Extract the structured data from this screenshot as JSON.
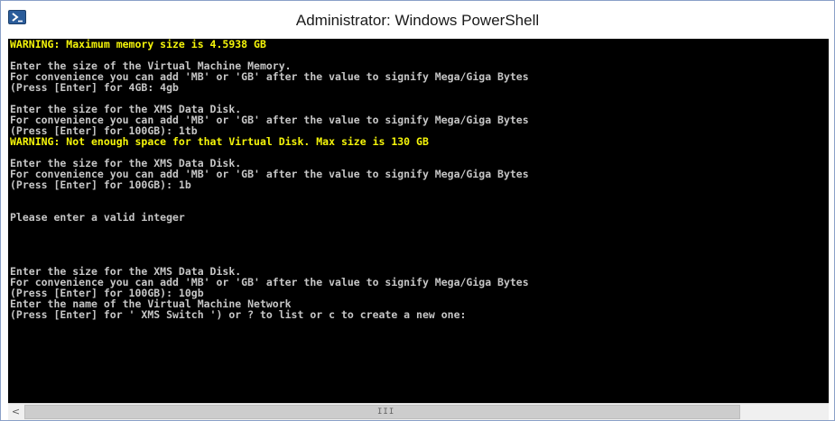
{
  "window": {
    "title": "Administrator: Windows PowerShell",
    "icon": "powershell-icon"
  },
  "console": {
    "foreground": "#c6c6c6",
    "warning_color": "#f5f50a",
    "background": "#000000",
    "lines": [
      {
        "text": "WARNING: Maximum memory size is 4.5938 GB",
        "warn": true
      },
      {
        "text": "",
        "warn": false
      },
      {
        "text": "Enter the size of the Virtual Machine Memory.",
        "warn": false
      },
      {
        "text": "For convenience you can add 'MB' or 'GB' after the value to signify Mega/Giga Bytes",
        "warn": false
      },
      {
        "text": "(Press [Enter] for 4GB: 4gb",
        "warn": false
      },
      {
        "text": "",
        "warn": false
      },
      {
        "text": "Enter the size for the XMS Data Disk.",
        "warn": false
      },
      {
        "text": "For convenience you can add 'MB' or 'GB' after the value to signify Mega/Giga Bytes",
        "warn": false
      },
      {
        "text": "(Press [Enter] for 100GB): 1tb",
        "warn": false
      },
      {
        "text": "WARNING: Not enough space for that Virtual Disk. Max size is 130 GB",
        "warn": true
      },
      {
        "text": "",
        "warn": false
      },
      {
        "text": "Enter the size for the XMS Data Disk.",
        "warn": false
      },
      {
        "text": "For convenience you can add 'MB' or 'GB' after the value to signify Mega/Giga Bytes",
        "warn": false
      },
      {
        "text": "(Press [Enter] for 100GB): 1b",
        "warn": false
      },
      {
        "text": "",
        "warn": false
      },
      {
        "text": "",
        "warn": false
      },
      {
        "text": "Please enter a valid integer",
        "warn": false
      },
      {
        "text": "",
        "warn": false
      },
      {
        "text": "",
        "warn": false
      },
      {
        "text": "",
        "warn": false
      },
      {
        "text": "",
        "warn": false
      },
      {
        "text": "Enter the size for the XMS Data Disk.",
        "warn": false
      },
      {
        "text": "For convenience you can add 'MB' or 'GB' after the value to signify Mega/Giga Bytes",
        "warn": false
      },
      {
        "text": "(Press [Enter] for 100GB): 10gb",
        "warn": false
      },
      {
        "text": "Enter the name of the Virtual Machine Network",
        "warn": false
      },
      {
        "text": "(Press [Enter] for ' XMS Switch ') or ? to list or c to create a new one:",
        "warn": false
      }
    ]
  },
  "scrollbar": {
    "left_arrow": "<",
    "grip": "III",
    "left_icon": "chevron-left-icon"
  }
}
